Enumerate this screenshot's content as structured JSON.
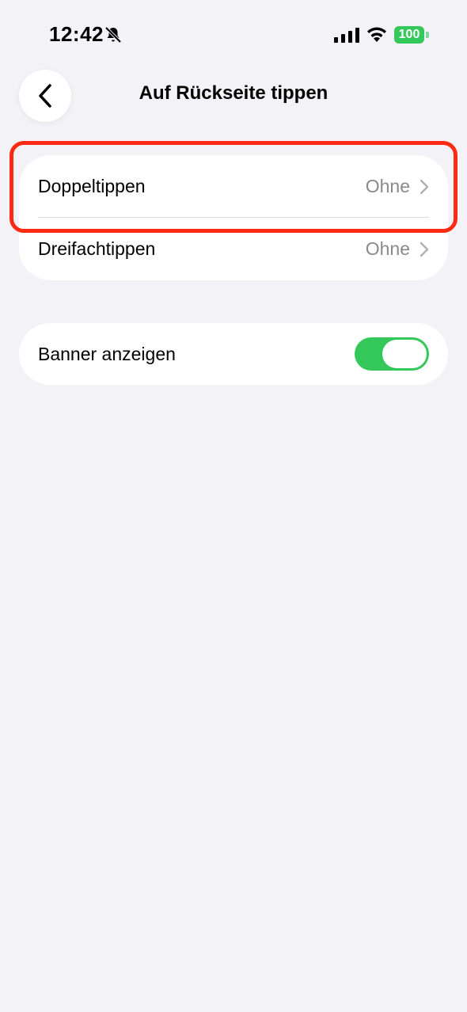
{
  "status_bar": {
    "time": "12:42",
    "battery_level": "100",
    "icons": [
      "bell-slash-icon",
      "cellular-signal-icon",
      "wifi-icon",
      "battery-icon"
    ],
    "battery_color": "#34c759"
  },
  "nav": {
    "title": "Auf Rückseite tippen",
    "back_icon": "chevron-left-icon"
  },
  "settings": {
    "tap_actions": [
      {
        "label": "Doppeltippen",
        "value": "Ohne"
      },
      {
        "label": "Dreifachtippen",
        "value": "Ohne"
      }
    ],
    "banner": {
      "label": "Banner anzeigen",
      "toggle_on": true
    }
  },
  "annotation": {
    "highlight_color": "#ff2a14"
  },
  "colors": {
    "background": "#f2f2f7",
    "secondary_text": "#8a8a8e",
    "toggle_on": "#34c759"
  }
}
